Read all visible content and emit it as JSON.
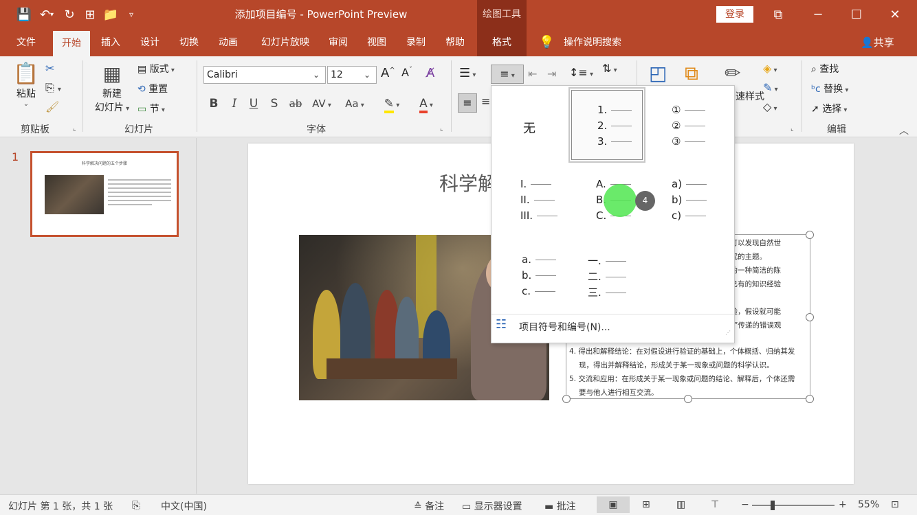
{
  "titlebar": {
    "title": "添加项目编号  -  PowerPoint Preview",
    "context_tab": "绘图工具",
    "login": "登录",
    "minimize": "─",
    "maximize": "☐",
    "close": "✕",
    "restore_ribbon": "⧉"
  },
  "tabs": [
    "文件",
    "开始",
    "插入",
    "设计",
    "切换",
    "动画",
    "幻灯片放映",
    "审阅",
    "视图",
    "录制",
    "帮助",
    "格式"
  ],
  "tell_me": "操作说明搜索",
  "share": "共享",
  "ribbon": {
    "clipboard": {
      "paste": "粘贴",
      "group": "剪贴板"
    },
    "slides": {
      "new_slide_line1": "新建",
      "new_slide_line2": "幻灯片",
      "layout": "版式",
      "reset": "重置",
      "section": "节",
      "group": "幻灯片"
    },
    "font": {
      "family": "Calibri",
      "size": "12",
      "bold": "B",
      "italic": "I",
      "underline": "U",
      "shadow": "S",
      "strike": "ab",
      "spacing": "AV",
      "case": "Aa",
      "grow": "A^",
      "shrink": "Aˇ",
      "group": "字体"
    },
    "drawing": {
      "quick_styles": "速样式"
    },
    "editing": {
      "find": "查找",
      "replace": "替换",
      "select": "选择",
      "group": "编辑"
    }
  },
  "thumbnail": {
    "number": "1",
    "title": "科学解决问题的五个步骤"
  },
  "slide": {
    "title": "科学解",
    "lines_top": [
      "过观察可以发现自然世",
      "确立探究的主题。",
      "于问题的一种简洁的陈",
      "个体在已有的知识经验",
      "通过检验，假设就可能",
      "在“权威”传递的错误观"
    ],
    "item4_line1": "4.   得出和解释结论：在对假设进行验证的基础上，个体概括、归纳其发",
    "item4_line2": "现，得出并解释结论，形成关于某一现象或问题的科学认识。",
    "item5_line1": "5.   交流和应用：在形成关于某一现象或问题的结论、解释后，个体还需",
    "item5_line2": "要与他人进行相互交流。"
  },
  "gallery": {
    "none": "无",
    "formats": [
      [
        "1.",
        "2.",
        "3."
      ],
      [
        "①",
        "②",
        "③"
      ],
      [
        "I.",
        "II.",
        "III."
      ],
      [
        "A.",
        "B.",
        "C."
      ],
      [
        "a)",
        "b)",
        "c)"
      ],
      [
        "a.",
        "b.",
        "c."
      ],
      [
        "一.",
        "二.",
        "三."
      ]
    ],
    "footer": "项目符号和编号(N)..."
  },
  "cursor_badge": "4",
  "statusbar": {
    "slide_info": "幻灯片 第 1 张，共 1 张",
    "language": "中文(中国)",
    "notes": "备注",
    "display": "显示器设置",
    "comments": "批注",
    "zoom": "55%",
    "zoom_minus": "−",
    "zoom_plus": "+"
  }
}
